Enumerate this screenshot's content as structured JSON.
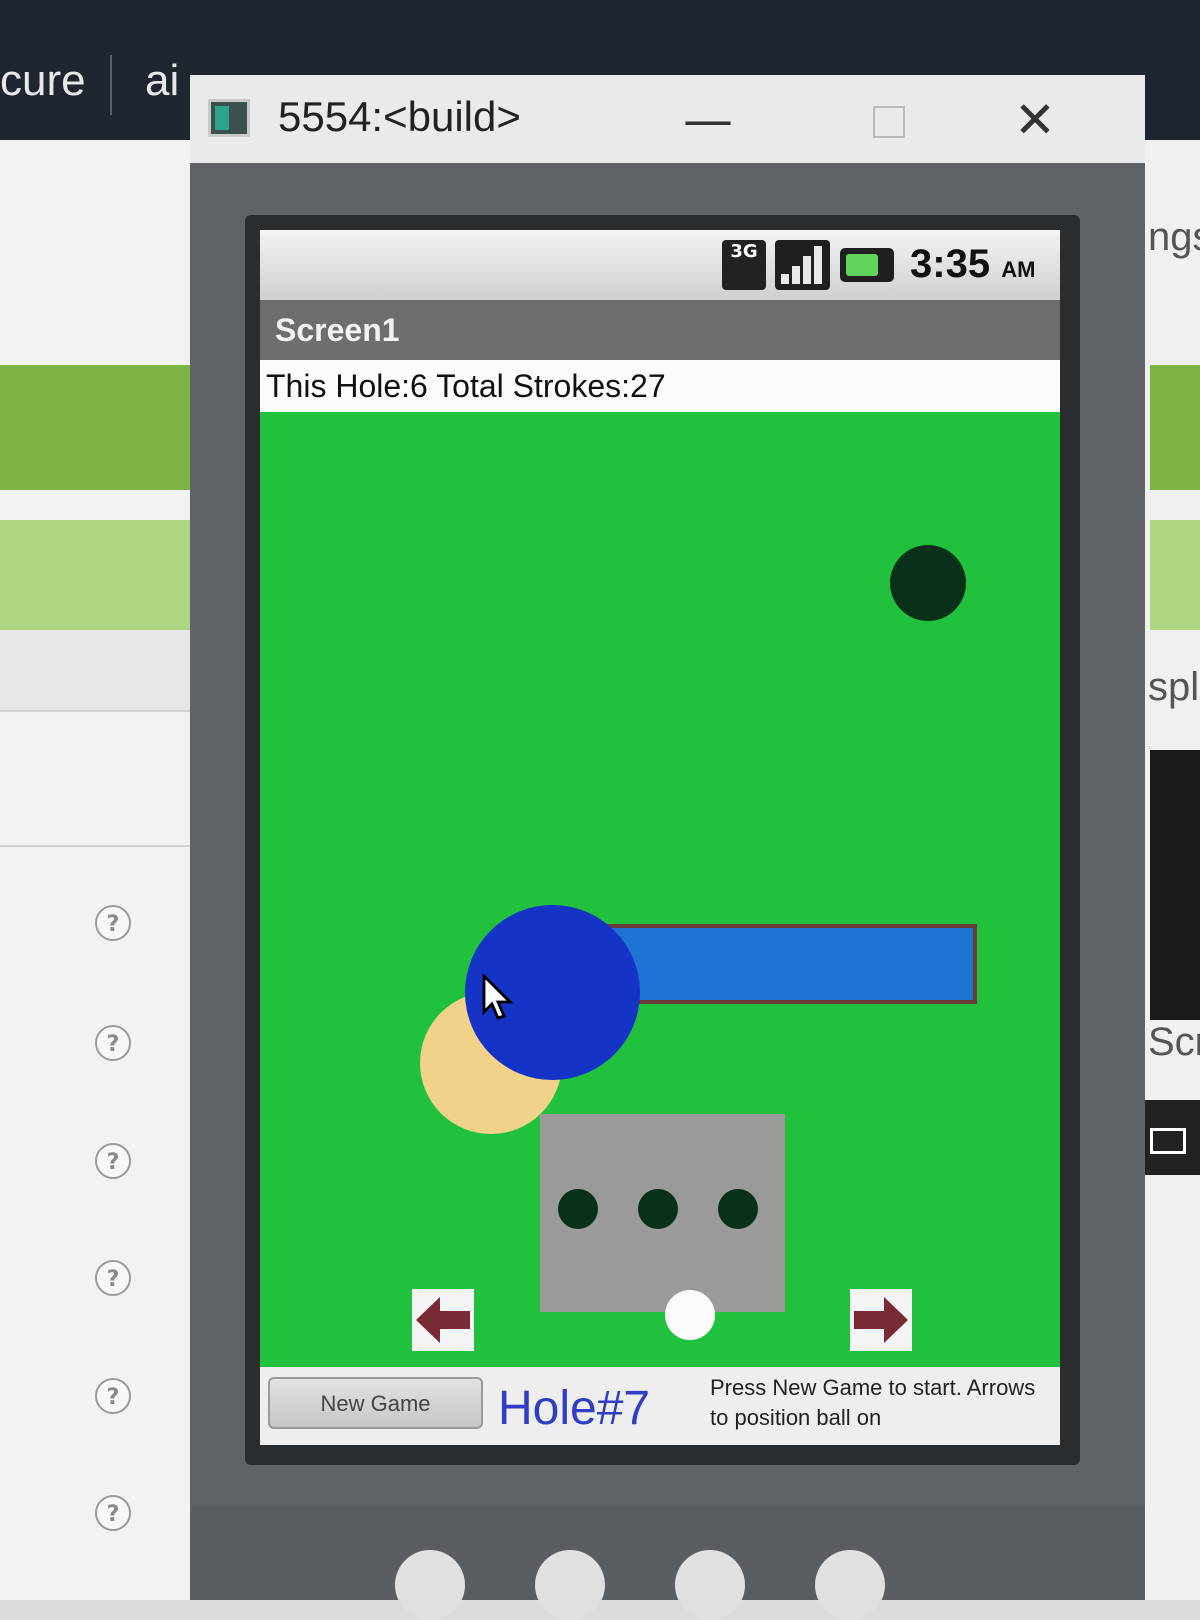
{
  "host_page": {
    "tab_fragment_left": "cure",
    "tab_fragment_ai": "ai",
    "right_fragments": [
      "ngs",
      "spl",
      "Scr"
    ]
  },
  "window": {
    "title": "5554:<build>",
    "minimize_glyph": "—",
    "close_glyph": "✕"
  },
  "status_bar": {
    "network": "3G",
    "time": "3:35",
    "ampm": "AM"
  },
  "app": {
    "title": "Screen1",
    "score_label": "This Hole:6 Total Strokes:27",
    "hole_label": "Hole#7",
    "instructions": "Press New Game to start. Arrows to position ball on",
    "new_game_label": "New Game"
  },
  "icons": {
    "help": "?",
    "left_arrow": "left-arrow-icon",
    "right_arrow": "right-arrow-icon"
  },
  "colors": {
    "course": "#22c13d",
    "ball": "#1533c4",
    "water": "#1f73d3",
    "sand": "#f0d28a",
    "hole": "#08301a"
  }
}
